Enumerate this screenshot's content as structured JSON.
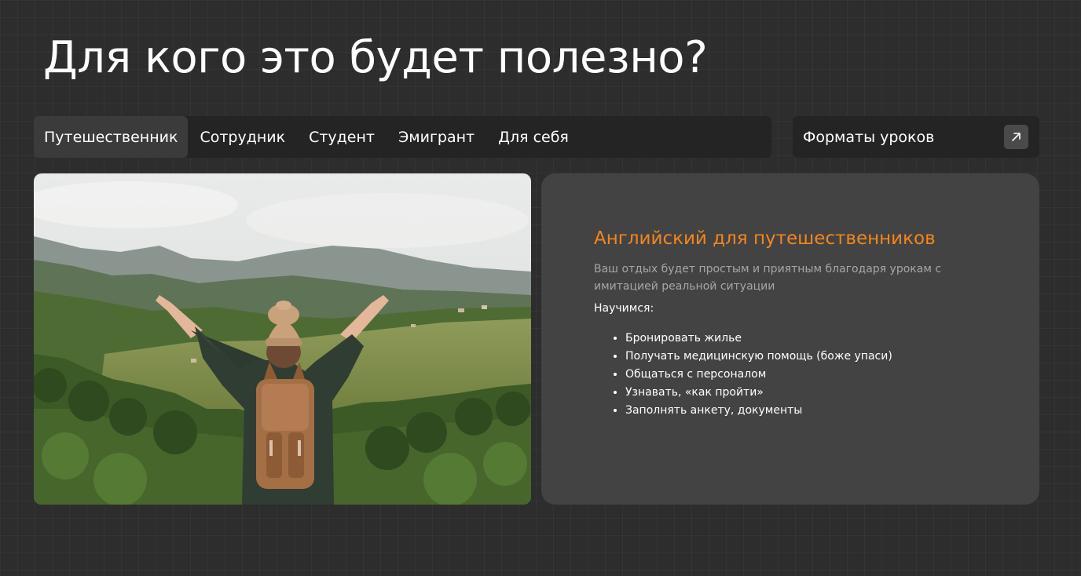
{
  "page": {
    "title": "Для кого это будет полезно?"
  },
  "tabs": [
    {
      "label": "Путешественник",
      "active": true
    },
    {
      "label": "Сотрудник",
      "active": false
    },
    {
      "label": "Студент",
      "active": false
    },
    {
      "label": "Эмигрант",
      "active": false
    },
    {
      "label": "Для себя",
      "active": false
    }
  ],
  "formats": {
    "label": "Форматы уроков",
    "icon": "arrow-up-right-icon"
  },
  "info": {
    "title": "Английский для путешественников",
    "description": "Ваш отдых будет простым и приятным благодаря урокам с имитацией реальной ситуации",
    "learn_heading": "Научимся:",
    "items": [
      "Бронировать жилье",
      "Получать медицинскую помощь (боже упаси)",
      "Общаться с персоналом",
      "Узнавать, «как пройти»",
      "Заполнять анкету, документы"
    ]
  },
  "colors": {
    "background": "#2d2d2d",
    "accent": "#f2861e",
    "panel": "#434343",
    "bar": "#242424",
    "active_tab": "#3b3b3b"
  }
}
